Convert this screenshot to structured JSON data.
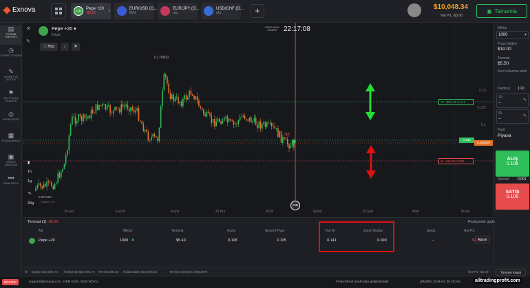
{
  "brand": {
    "name": "Exnova"
  },
  "tabs": [
    {
      "badge": "22B",
      "title": "Pepe +20",
      "sub": "-$3.00",
      "neg": true,
      "color": "#3fa34d"
    },
    {
      "title": "EUR/USD (O...",
      "sub": "85%",
      "neg": false,
      "color": "#3b5bd6"
    },
    {
      "title": "EUR/JPY (O...",
      "sub": "n/a",
      "neg": false,
      "color": "#c23b5b"
    },
    {
      "title": "USD/CHF (O...",
      "sub": "n/a",
      "neg": false,
      "color": "#3b6bd6"
    }
  ],
  "account": {
    "balance": "$10,048.34",
    "net_pl": "Net P/L -$3.00",
    "deposit": "Tamamla"
  },
  "left_nav": [
    {
      "icon": "▤",
      "label": "TOPLAM PORTFÖY",
      "active": true
    },
    {
      "icon": "◷",
      "label": "TİCARET GEÇMİŞİ"
    },
    {
      "icon": "✎",
      "label": "SOHBET VE DESTEK"
    },
    {
      "icon": "⚑",
      "label": "EN İYİ SATIŞ ARIDLERI"
    },
    {
      "icon": "◎",
      "label": "PROMOSYON"
    },
    {
      "icon": "▦",
      "label": "PİYASA ANALİZİ"
    },
    {
      "icon": "▣",
      "label": "EĞİTİCİ VİDEOLAR"
    },
    {
      "icon": "•••",
      "label": "DAHA FAZLA"
    }
  ],
  "chart": {
    "asset": "Pepe +20",
    "asset_type": "Kripto",
    "info_btn": "Bilgi",
    "expiry_label": "SATIN ALMA ZAMANI",
    "clock": "22:17:08",
    "high_label": "0.174500",
    "low_label": "0.067500",
    "y_ticks": [
      "0.15",
      "0.125",
      "0.1",
      "0.075"
    ],
    "x_ticks": [
      "26 Eki",
      "Kasım",
      "Aralık",
      "28 Ara",
      "2024",
      "Şubat",
      "29 Şub",
      "Mart",
      "Nisan"
    ],
    "tp_label": "TP +$33.00 0.141",
    "sl_label": "SL -$18.00 0.090",
    "price_tag": "0.108",
    "bid_tag": "0.105500",
    "pl_float": "-$3",
    "timeframes": [
      "1h",
      "1g",
      "30g"
    ],
    "expiry_badge": "22B",
    "chart_hint": "Haftalık 1.15"
  },
  "right_panel": {
    "amount_label": "Miktar",
    "amount": "1000",
    "point_label": "Puan Değeri",
    "point": "$10.00",
    "margin_label": "Teminat",
    "margin": "$5.50",
    "last_label": "Son kullanma tarihi",
    "last": "",
    "leverage_label": "Kaldıraç",
    "leverage": "1:20",
    "tp_label": "TP",
    "tp_value": "--",
    "sl_label": "SL",
    "sl_value": "--",
    "price_label": "Fiyat",
    "price_mode": "Piyasa",
    "buy_label": "ALIŞ",
    "buy_price": "0.106",
    "spread_label": "Spread",
    "spread": "0.001",
    "sell_label": "SATIŞ",
    "sell_price": "0.105"
  },
  "positions": {
    "tab": "Teminat (1)",
    "tab_pl": "-$3.00",
    "settings": "Pozisyonlar güçle",
    "headers": [
      "Ad",
      "Miktar",
      "Teminat",
      "Açılış",
      "Geçerli Fiyat",
      "Kar Al",
      "Zarar Durdur",
      "Swap",
      "Net P/L"
    ],
    "row": [
      "Pepe +20",
      "1000",
      "$5.40",
      "0.108",
      "0.105",
      "0.141",
      "0.090",
      "--",
      "-$3.00"
    ],
    "close_btn": "Kapat"
  },
  "status": {
    "balance": "Bakiye $10,056.74",
    "equity": "Özkaynak $10,053.74",
    "margin": "Teminat $5.40",
    "available": "Kullanılabilir $10,048.34",
    "level": "Teminat Seviyesi 186180%",
    "net_pl": "Net P/L -$3.00",
    "close_all": "Tümünü Kapat"
  },
  "footer": {
    "support_btn": "DESTEK",
    "email": "support@exnova.com",
    "slogan": "HER GÜN, GÜN BOYU",
    "powered": "FintechFuel tarafından geliştirilmiştir",
    "time": "ŞİMDİKİ ZAMAN: 29 OCAK",
    "watermark": "alltradingprofit.com"
  }
}
